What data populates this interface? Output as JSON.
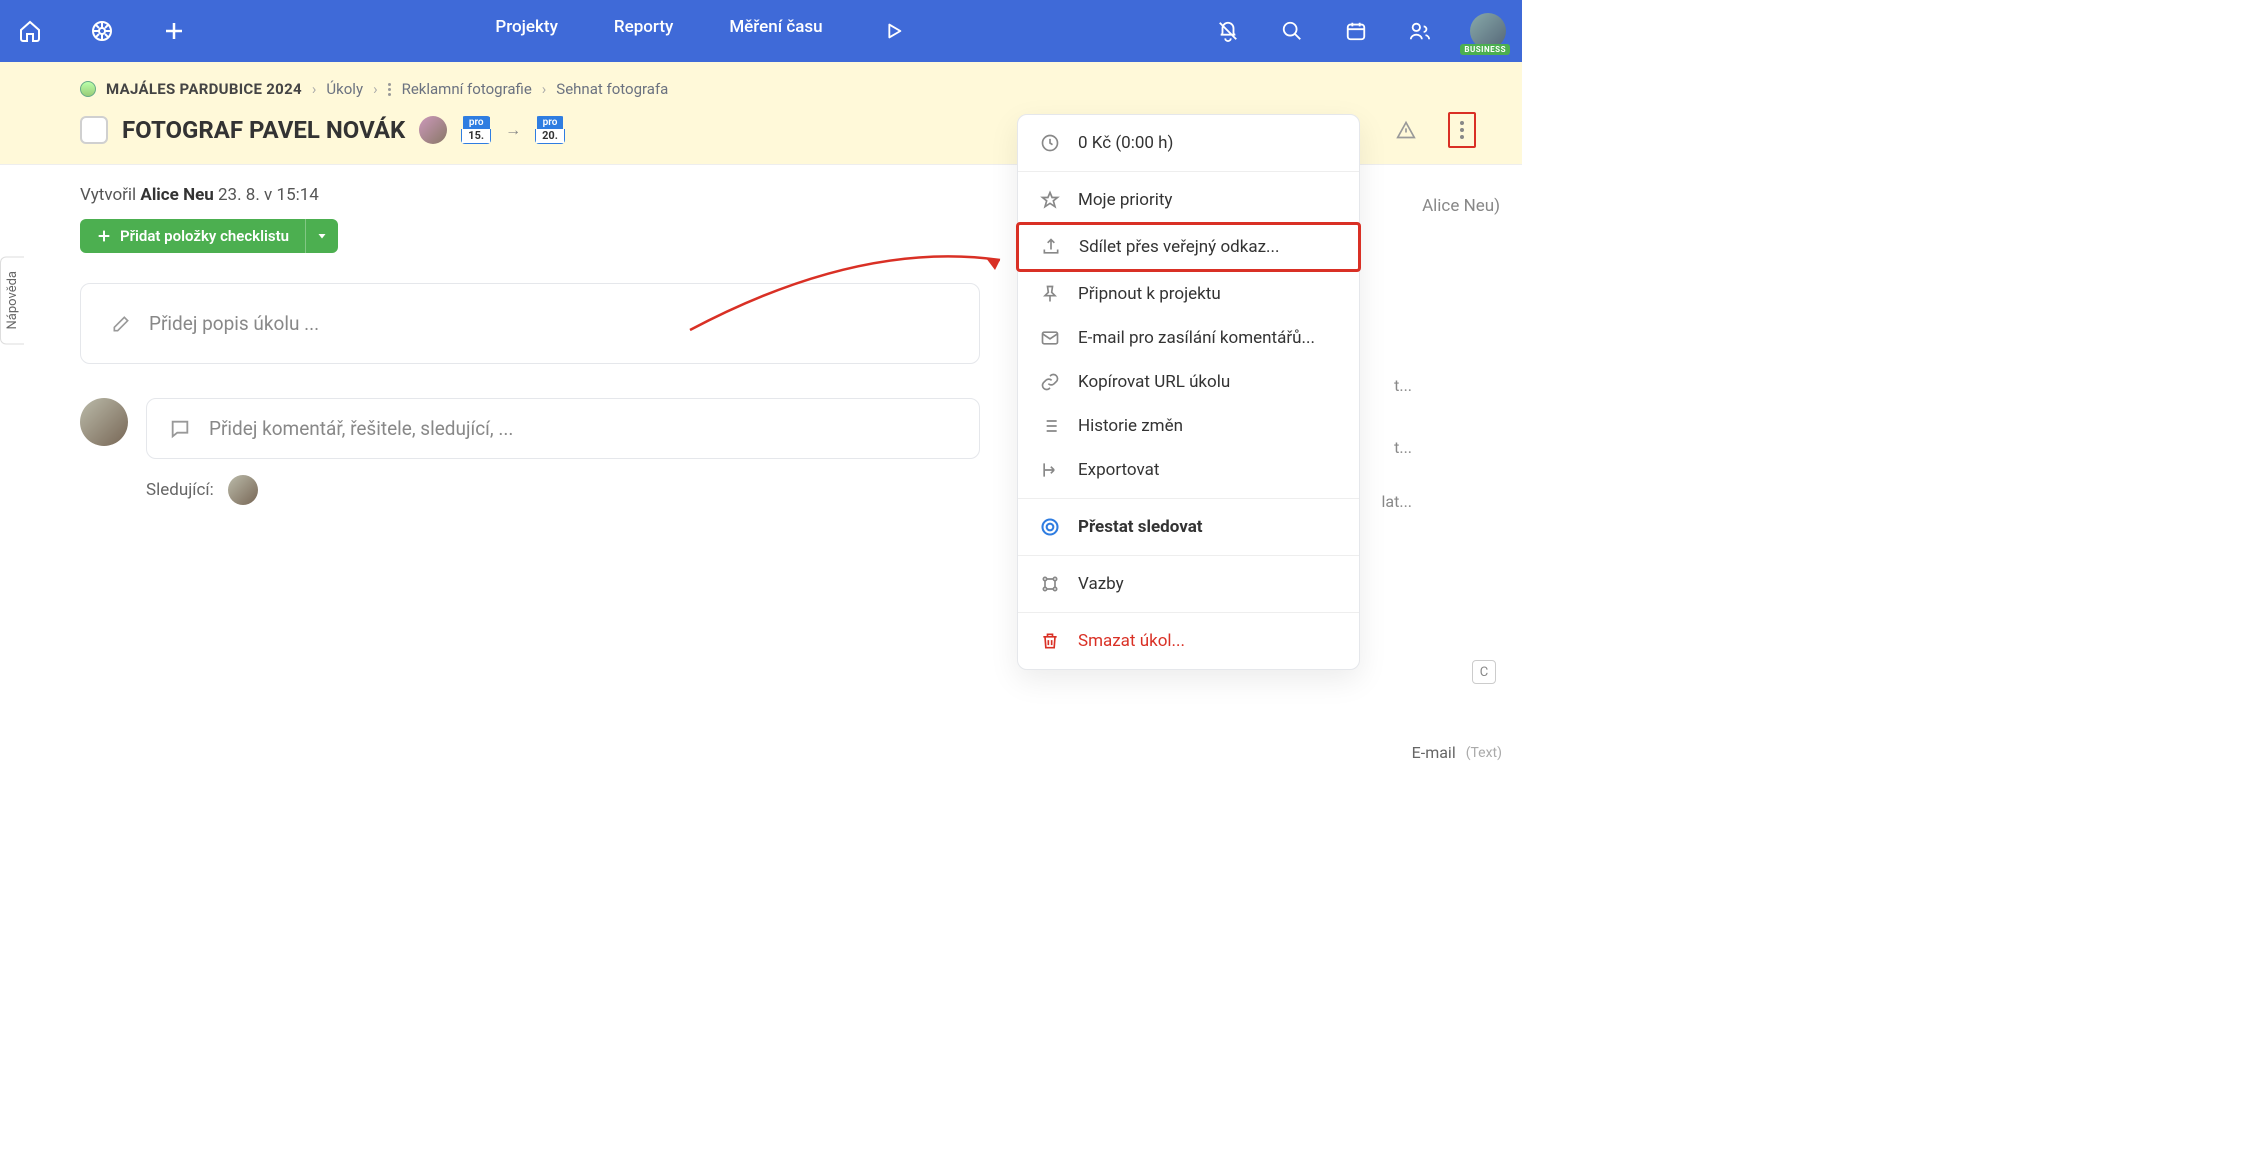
{
  "topbar": {
    "nav": [
      "Projekty",
      "Reporty",
      "Měření času"
    ]
  },
  "avatar_badge": "BUSINESS",
  "breadcrumb": {
    "project": "MAJÁLES PARDUBICE 2024",
    "items": [
      "Úkoly",
      "Reklamní fotografie",
      "Sehnat fotografa"
    ]
  },
  "task": {
    "title": "FOTOGRAF PAVEL NOVÁK",
    "date_from_label": "pro",
    "date_from": "15.",
    "date_to_label": "pro",
    "date_to": "20."
  },
  "meta": {
    "prefix": "Vytvořil",
    "author": "Alice Neu",
    "when": "23. 8. v 15:14"
  },
  "checklist_btn": "Přidat položky checklistu",
  "desc_placeholder": "Přidej popis úkolu ...",
  "comment_placeholder": "Přidej komentář, řešitele, sledující, ...",
  "followers_label": "Sledující:",
  "menu": {
    "time_cost": "0 Kč (0:00 h)",
    "items": [
      "Moje priority",
      "Sdílet přes veřejný odkaz...",
      "Připnout k projektu",
      "E-mail pro zasílání komentářů...",
      "Kopírovat URL úkolu",
      "Historie změn",
      "Exportovat"
    ],
    "watch": "Přestat sledovat",
    "links": "Vazby",
    "delete": "Smazat úkol..."
  },
  "right_peek": "Alice Neu)",
  "right_truncated": [
    "t...",
    "t...",
    "lat..."
  ],
  "email_field_label": "E-mail",
  "email_field_hint": "(Text)",
  "help_tab": "Nápověda"
}
